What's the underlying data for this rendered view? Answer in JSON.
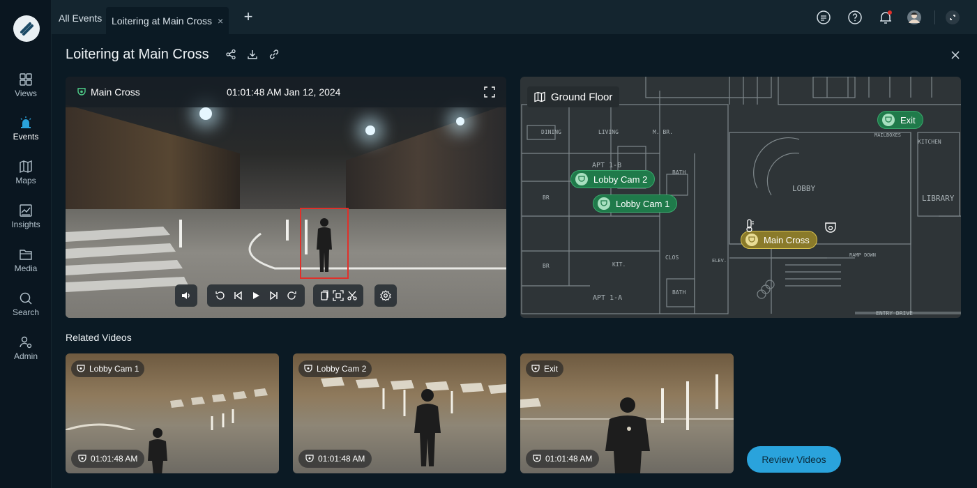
{
  "tabs": {
    "all_events": "All Events",
    "active": "Loitering at Main Cross",
    "close_symbol": "×"
  },
  "nav": {
    "items": [
      {
        "label": "Views"
      },
      {
        "label": "Events"
      },
      {
        "label": "Maps"
      },
      {
        "label": "Insights"
      },
      {
        "label": "Media"
      },
      {
        "label": "Search"
      },
      {
        "label": "Admin"
      }
    ]
  },
  "header": {
    "title": "Loitering at Main Cross"
  },
  "video": {
    "camera": "Main Cross",
    "timestamp": "01:01:48 AM  Jan 12, 2024"
  },
  "map": {
    "floor": "Ground Floor",
    "cameras": [
      {
        "name": "Exit"
      },
      {
        "name": "Lobby Cam 2"
      },
      {
        "name": "Lobby Cam 1"
      },
      {
        "name": "Main Cross"
      }
    ],
    "rooms": [
      "DINING",
      "LIVING",
      "M. BR.",
      "BATH",
      "APT 1-B",
      "BR",
      "KIT.",
      "LOBBY",
      "LIBRARY",
      "KITCHEN",
      "MAILBOXES",
      "CLOS",
      "ELEV.",
      "BATH",
      "APT 1-A",
      "ENTRY DRIVE",
      "RAMP DOWN",
      "BR"
    ]
  },
  "related": {
    "title": "Related Videos",
    "videos": [
      {
        "camera": "Lobby Cam 1",
        "time": "01:01:48 AM"
      },
      {
        "camera": "Lobby Cam 2",
        "time": "01:01:48 AM"
      },
      {
        "camera": "Exit",
        "time": "01:01:48 AM"
      }
    ],
    "review_label": "Review Videos"
  },
  "colors": {
    "accent": "#2aa3dc",
    "camera_green": "#1f7a4a",
    "camera_active": "#8a7a2a",
    "detection": "#e0302a"
  }
}
